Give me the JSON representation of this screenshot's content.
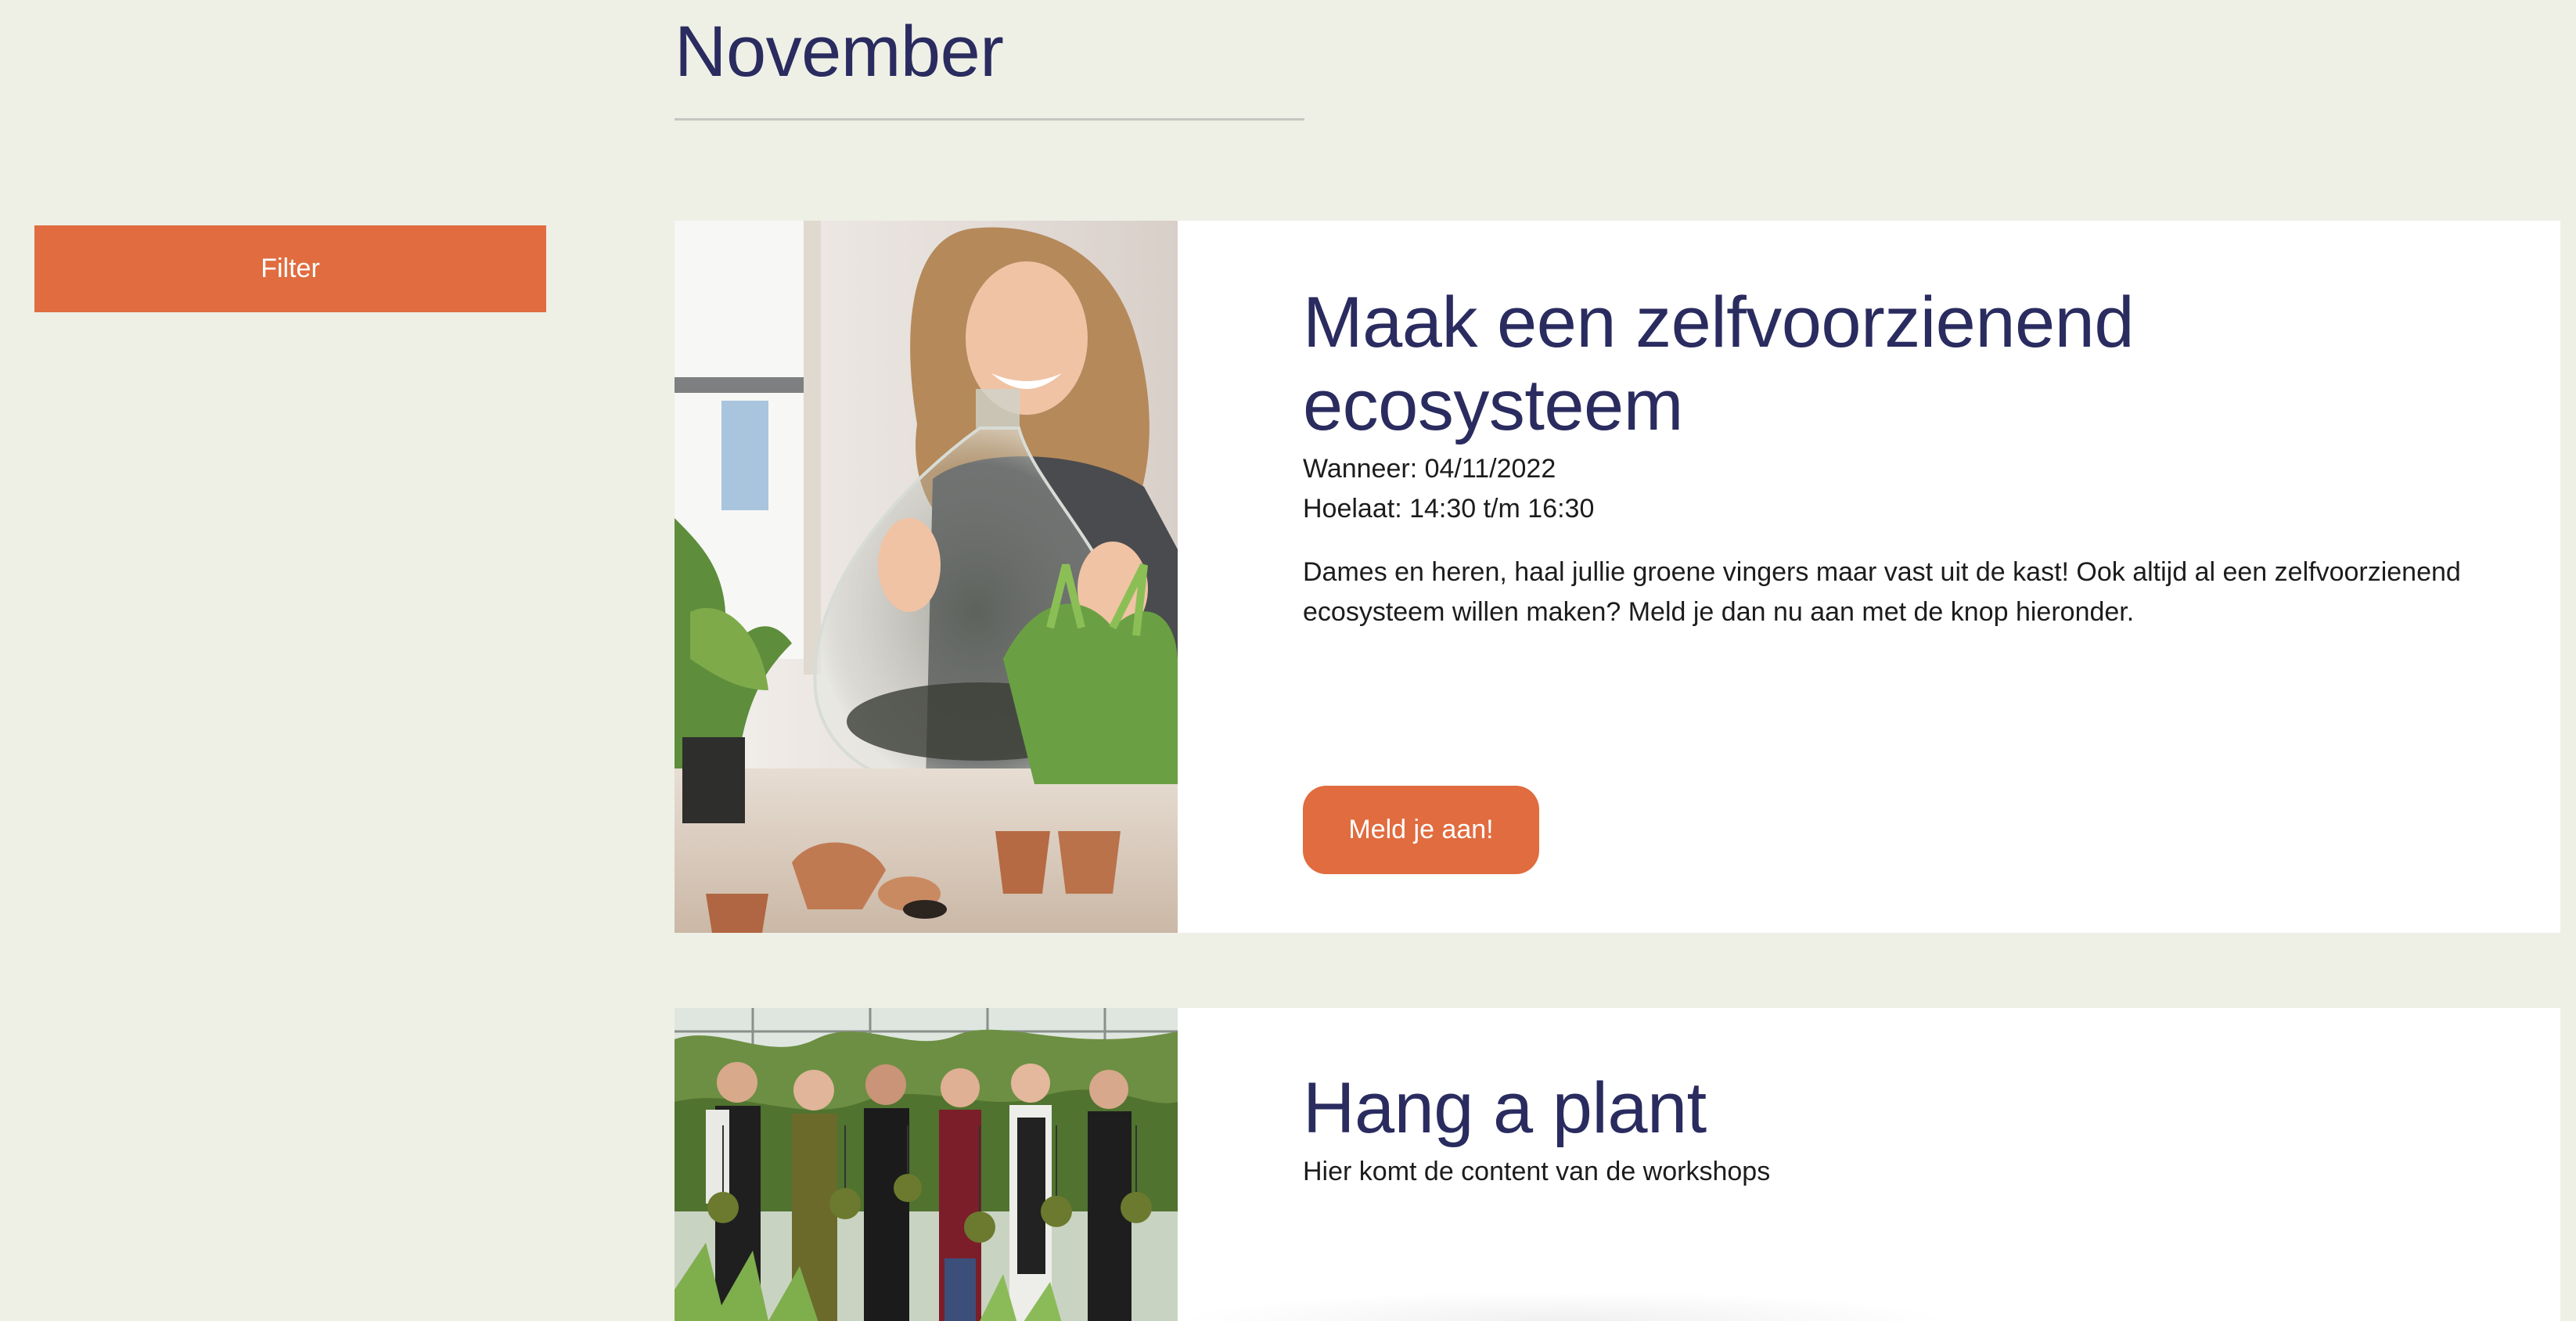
{
  "month": {
    "title": "November"
  },
  "sidebar": {
    "filter_label": "Filter"
  },
  "events": [
    {
      "title": "Maak een zelfvoorzienend ecosysteem",
      "when": "Wanneer: 04/11/2022",
      "time": "Hoelaat: 14:30 t/m 16:30",
      "description": "Dames en heren, haal jullie groene vingers maar vast uit de kast! Ook altijd al een zelfvoorzienend ecosysteem willen maken? Meld je dan nu aan met de knop hieronder.",
      "button_label": "Meld je aan!",
      "image": "woman-with-terrarium-photo"
    },
    {
      "title": "Hang a plant",
      "description": "Hier komt de content van de workshops",
      "image": "group-with-hanging-plants-photo"
    }
  ],
  "colors": {
    "background": "#eef0e6",
    "accent": "#e06c3f",
    "heading": "#2a2b5f",
    "text": "#1c1c1c",
    "card": "#ffffff"
  }
}
